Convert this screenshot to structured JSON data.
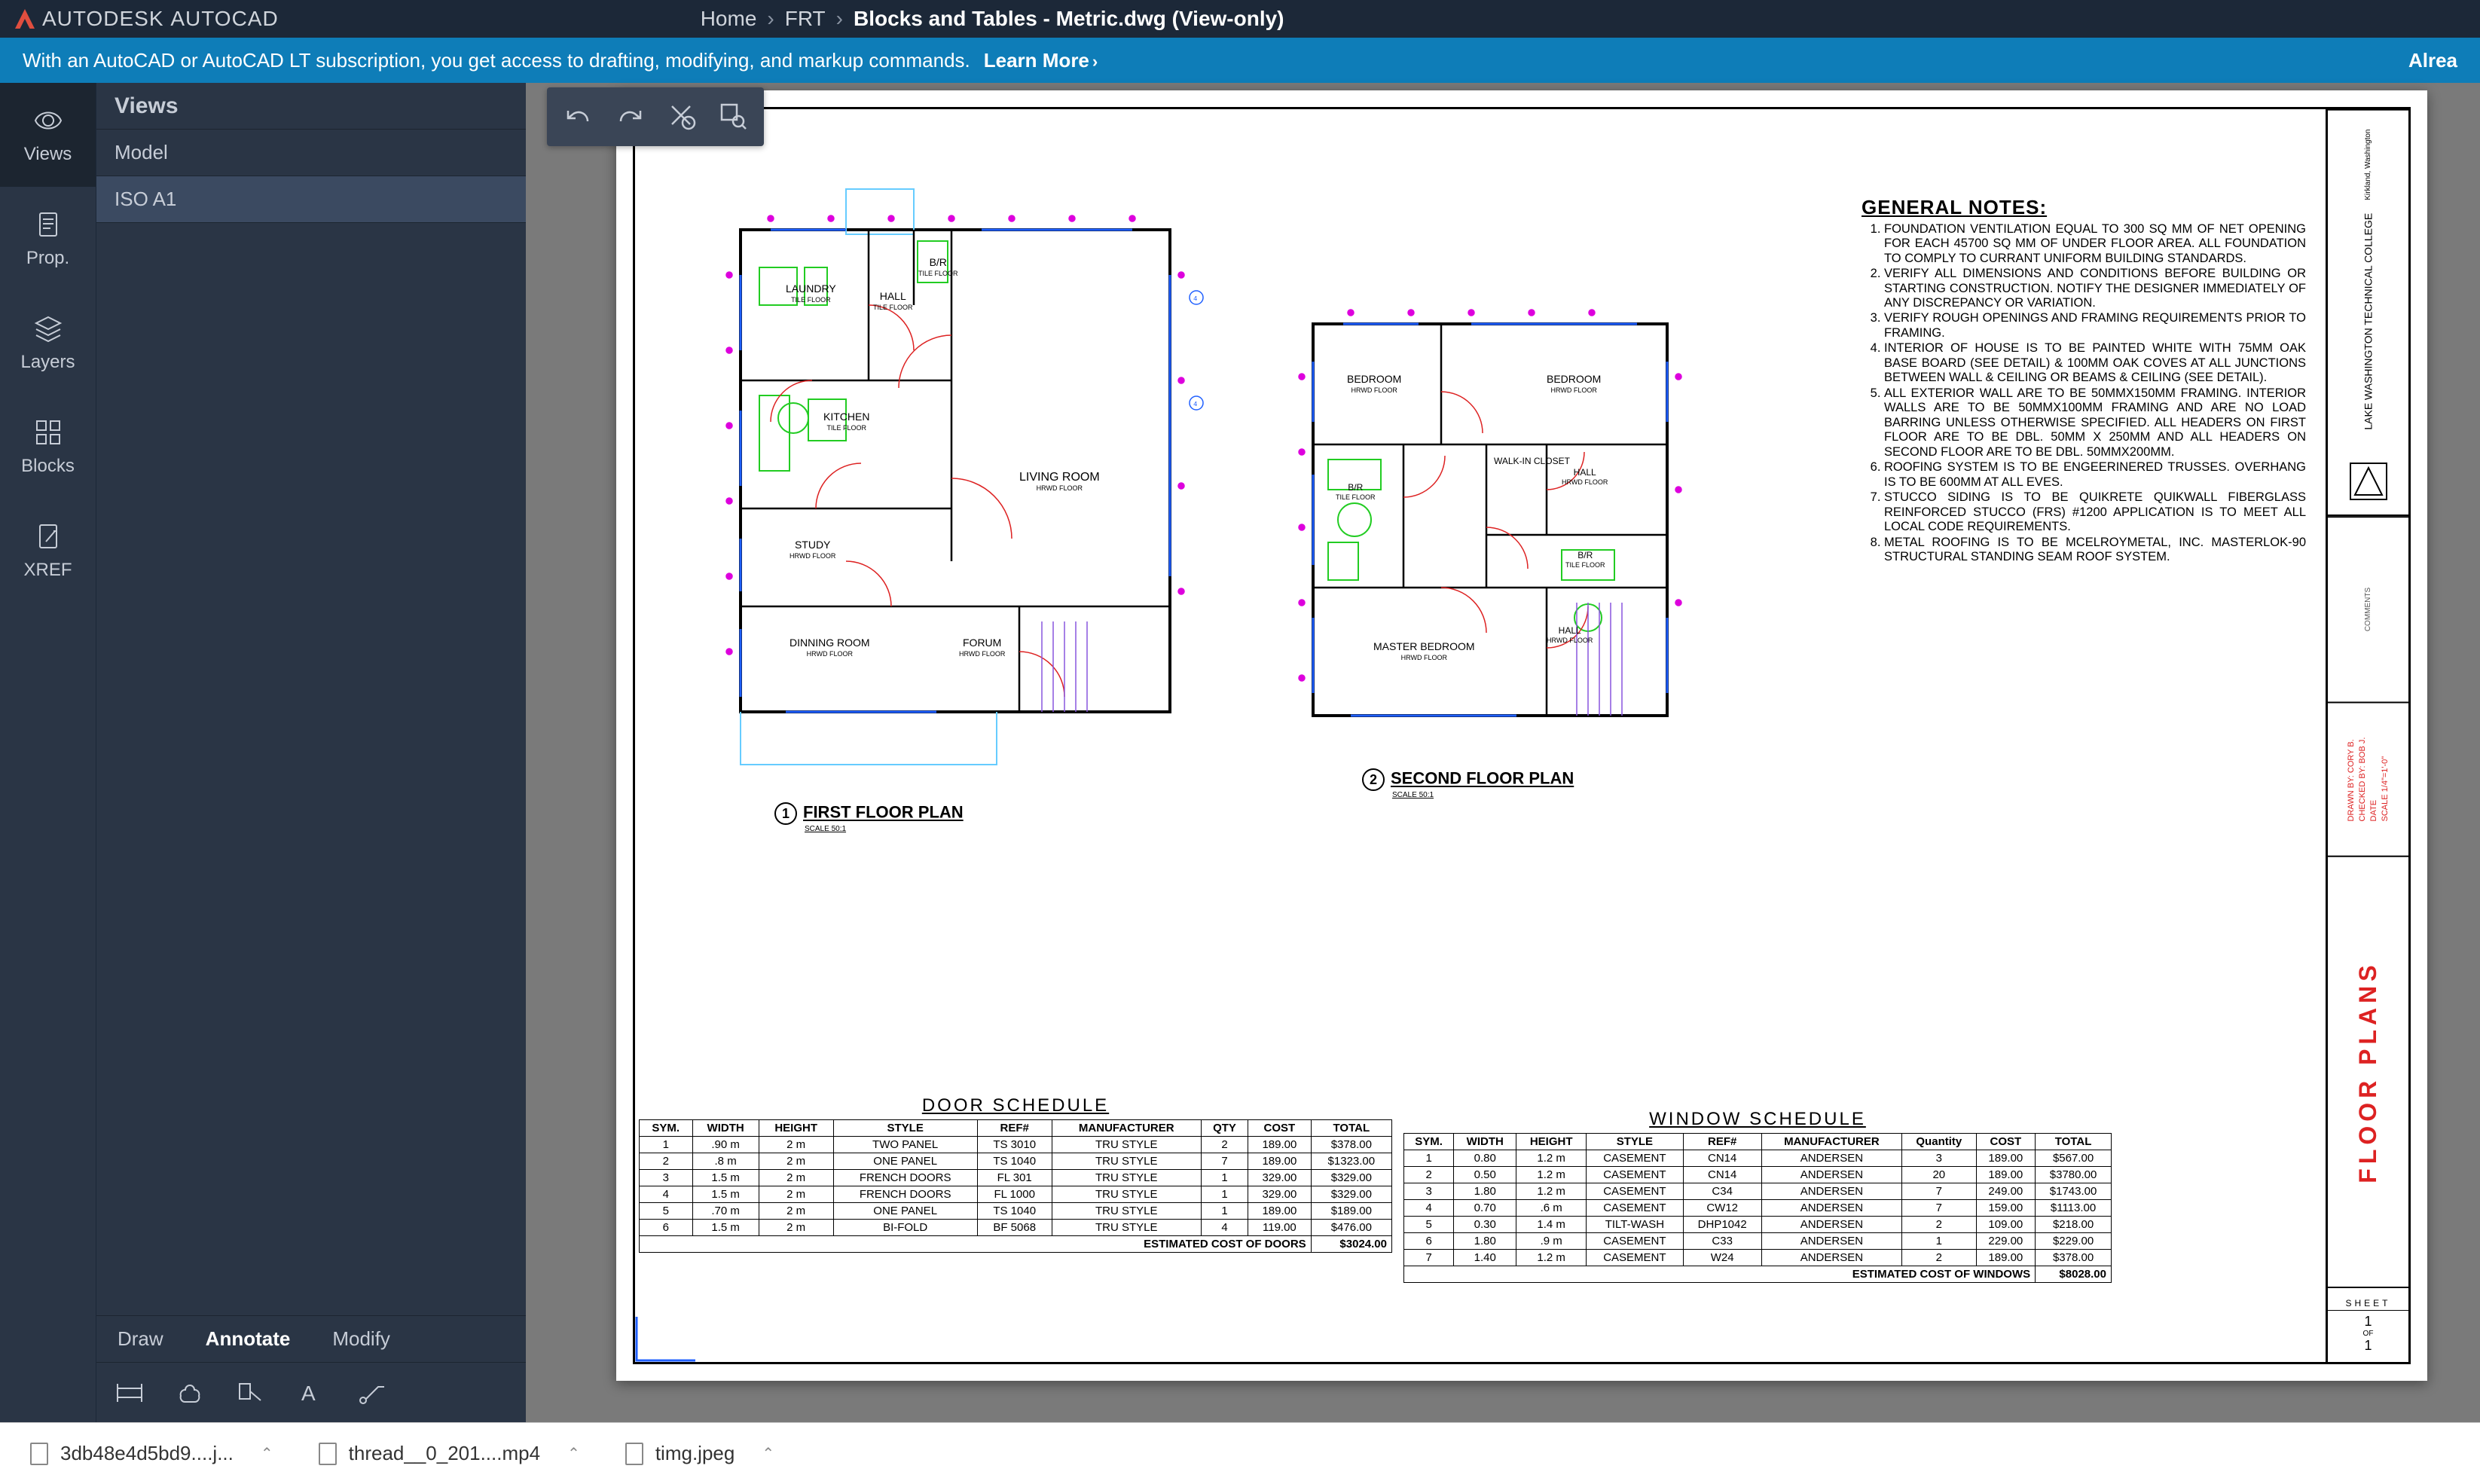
{
  "header": {
    "brand_a": "AUTODESK",
    "brand_b": "AUTOCAD",
    "crumbs": [
      "Home",
      "FRT",
      "Blocks and Tables - Metric.dwg (View-only)"
    ]
  },
  "banner": {
    "text": "With an AutoCAD or AutoCAD LT subscription, you get access to drafting, modifying, and markup commands.",
    "learn": "Learn More",
    "right": "Alrea"
  },
  "rail": {
    "items": [
      {
        "label": "Views",
        "icon": "eye"
      },
      {
        "label": "Prop.",
        "icon": "doc"
      },
      {
        "label": "Layers",
        "icon": "layers"
      },
      {
        "label": "Blocks",
        "icon": "blocks"
      },
      {
        "label": "XREF",
        "icon": "xref"
      }
    ]
  },
  "sidepanel": {
    "title": "Views",
    "items": [
      {
        "label": "Model",
        "selected": false
      },
      {
        "label": "ISO A1",
        "selected": true
      }
    ],
    "bottom_tabs": [
      "Draw",
      "Annotate",
      "Modify"
    ],
    "bottom_selected": "Annotate"
  },
  "general_notes": {
    "heading": "GENERAL NOTES:",
    "items": [
      "FOUNDATION VENTILATION EQUAL TO 300 SQ MM OF NET OPENING FOR EACH 45700 SQ MM OF UNDER FLOOR AREA. ALL FOUNDATION TO COMPLY TO CURRANT UNIFORM BUILDING STANDARDS.",
      "VERIFY ALL DIMENSIONS AND CONDITIONS BEFORE BUILDING OR STARTING CONSTRUCTION. NOTIFY THE DESIGNER IMMEDIATELY OF ANY DISCREPANCY OR VARIATION.",
      "VERIFY ROUGH OPENINGS AND FRAMING REQUIREMENTS PRIOR TO FRAMING.",
      "INTERIOR OF HOUSE IS TO BE PAINTED WHITE WITH 75MM OAK BASE BOARD (SEE DETAIL) & 100MM OAK COVES AT ALL JUNCTIONS BETWEEN WALL & CEILING OR BEAMS & CEILING (SEE DETAIL).",
      "ALL EXTERIOR WALL ARE TO BE 50MMX150MM FRAMING. INTERIOR WALLS ARE TO BE 50MMX100MM FRAMING AND ARE NO LOAD BARRING UNLESS OTHERWISE SPECIFIED. ALL HEADERS ON FIRST FLOOR ARE TO BE DBL. 50MM X 250MM AND ALL HEADERS ON SECOND FLOOR ARE TO BE DBL. 50MMX200MM.",
      "ROOFING SYSTEM IS TO BE ENGEERINERED TRUSSES. OVERHANG IS TO BE 600MM AT ALL EVES.",
      "STUCCO SIDING IS TO BE QUIKRETE QUIKWALL FIBERGLASS REINFORCED STUCCO (FRS) #1200 APPLICATION IS TO MEET ALL LOCAL CODE REQUIREMENTS.",
      "METAL ROOFING IS TO BE MCELROYMETAL, INC. MASTERLOK-90 STRUCTURAL STANDING SEAM ROOF SYSTEM."
    ]
  },
  "floor1": {
    "title": "FIRST FLOOR PLAN",
    "scale": "SCALE 50:1",
    "rooms": {
      "laundry": "LAUNDRY",
      "hall1": "HALL",
      "br1": "B/R",
      "kitchen": "KITCHEN",
      "living": "LIVING ROOM",
      "study": "STUDY",
      "dining": "DINNING ROOM",
      "forum": "FORUM",
      "tile": "TILE FLOOR",
      "hrwd": "HRWD FLOOR"
    }
  },
  "floor2": {
    "title": "SECOND FLOOR PLAN",
    "scale": "SCALE 50:1",
    "rooms": {
      "bedroom1": "BEDROOM",
      "bedroom2": "BEDROOM",
      "walkin": "WALK-IN CLOSET",
      "hall": "HALL",
      "br": "B/R",
      "br2": "B/R",
      "master": "MASTER BEDROOM",
      "hall2": "HALL",
      "tile": "TILE FLOOR",
      "hrwd": "HRWD FLOOR"
    }
  },
  "door_schedule": {
    "title": "DOOR SCHEDULE",
    "headers": [
      "SYM.",
      "WIDTH",
      "HEIGHT",
      "STYLE",
      "REF#",
      "MANUFACTURER",
      "QTY",
      "COST",
      "TOTAL"
    ],
    "rows": [
      [
        "1",
        ".90 m",
        "2 m",
        "TWO PANEL",
        "TS 3010",
        "TRU STYLE",
        "2",
        "189.00",
        "$378.00"
      ],
      [
        "2",
        ".8 m",
        "2 m",
        "ONE PANEL",
        "TS 1040",
        "TRU STYLE",
        "7",
        "189.00",
        "$1323.00"
      ],
      [
        "3",
        "1.5 m",
        "2 m",
        "FRENCH DOORS",
        "FL 301",
        "TRU STYLE",
        "1",
        "329.00",
        "$329.00"
      ],
      [
        "4",
        "1.5 m",
        "2 m",
        "FRENCH DOORS",
        "FL 1000",
        "TRU STYLE",
        "1",
        "329.00",
        "$329.00"
      ],
      [
        "5",
        ".70 m",
        "2 m",
        "ONE PANEL",
        "TS 1040",
        "TRU STYLE",
        "1",
        "189.00",
        "$189.00"
      ],
      [
        "6",
        "1.5 m",
        "2 m",
        "BI-FOLD",
        "BF 5068",
        "TRU STYLE",
        "4",
        "119.00",
        "$476.00"
      ]
    ],
    "total_label": "ESTIMATED COST OF DOORS",
    "total": "$3024.00"
  },
  "window_schedule": {
    "title": "WINDOW SCHEDULE",
    "headers": [
      "SYM.",
      "WIDTH",
      "HEIGHT",
      "STYLE",
      "REF#",
      "MANUFACTURER",
      "Quantity",
      "COST",
      "TOTAL"
    ],
    "rows": [
      [
        "1",
        "0.80",
        "1.2 m",
        "CASEMENT",
        "CN14",
        "ANDERSEN",
        "3",
        "189.00",
        "$567.00"
      ],
      [
        "2",
        "0.50",
        "1.2 m",
        "CASEMENT",
        "CN14",
        "ANDERSEN",
        "20",
        "189.00",
        "$3780.00"
      ],
      [
        "3",
        "1.80",
        "1.2 m",
        "CASEMENT",
        "C34",
        "ANDERSEN",
        "7",
        "249.00",
        "$1743.00"
      ],
      [
        "4",
        "0.70",
        ".6 m",
        "CASEMENT",
        "CW12",
        "ANDERSEN",
        "7",
        "159.00",
        "$1113.00"
      ],
      [
        "5",
        "0.30",
        "1.4 m",
        "TILT-WASH",
        "DHP1042",
        "ANDERSEN",
        "2",
        "109.00",
        "$218.00"
      ],
      [
        "6",
        "1.80",
        ".9 m",
        "CASEMENT",
        "C33",
        "ANDERSEN",
        "1",
        "229.00",
        "$229.00"
      ],
      [
        "7",
        "1.40",
        "1.2 m",
        "CASEMENT",
        "W24",
        "ANDERSEN",
        "2",
        "189.00",
        "$378.00"
      ]
    ],
    "total_label": "ESTIMATED COST OF WINDOWS",
    "total": "$8028.00"
  },
  "title_block": {
    "school": "LAKE WASHINGTON TECHNICAL COLLEGE",
    "location": "Kirkland, Washington",
    "drawn_by": "DRAWN BY: CORY B.",
    "checked_by": "CHECKED BY: BOB J.",
    "date": "DATE",
    "scale": "SCALE 1/4\"=1'-0\"",
    "comments": "COMMENTS",
    "sheet_title": "FLOOR PLANS",
    "sheet_label": "SHEET",
    "sheet_num_top": "1",
    "sheet_of": "OF",
    "sheet_num_bot": "1"
  },
  "downloads": [
    {
      "name": "3db48e4d5bd9....j..."
    },
    {
      "name": "thread__0_201....mp4"
    },
    {
      "name": "timg.jpeg"
    }
  ]
}
